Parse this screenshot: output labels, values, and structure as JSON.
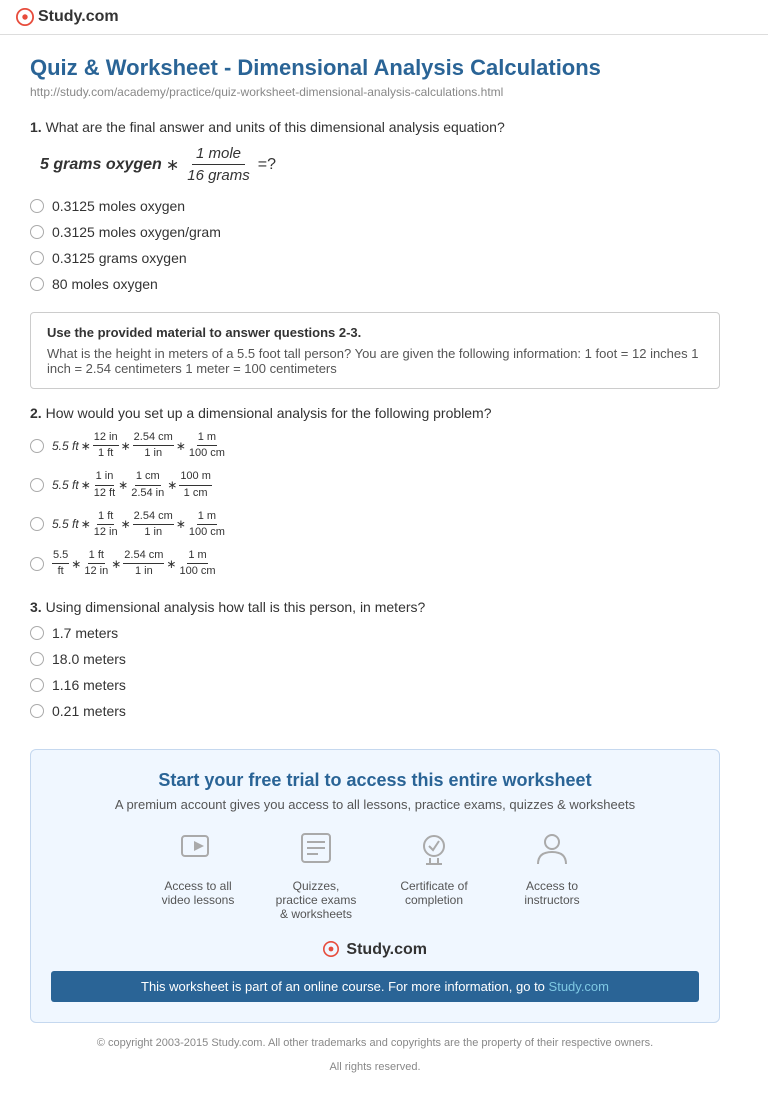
{
  "header": {
    "logo_text": "Study.com",
    "logo_dot": "●"
  },
  "page": {
    "title": "Quiz & Worksheet - Dimensional Analysis Calculations",
    "url": "http://study.com/academy/practice/quiz-worksheet-dimensional-analysis-calculations.html"
  },
  "questions": [
    {
      "number": "1.",
      "text": "What are the final answer and units of this dimensional analysis equation?",
      "equation_parts": {
        "left": "5 grams oxygen",
        "operator": "*",
        "numerator": "1 mole",
        "denominator": "16 grams",
        "result": "=?"
      },
      "options": [
        "0.3125 moles oxygen",
        "0.3125 moles oxygen/gram",
        "0.3125 grams oxygen",
        "80 moles oxygen"
      ]
    },
    {
      "info_box": {
        "title": "Use the provided material to answer questions 2-3.",
        "text": "What is the height in meters of a 5.5 foot tall person? You are given the following information: 1 foot = 12 inches 1 inch = 2.54 centimeters 1 meter = 100 centimeters"
      }
    },
    {
      "number": "2.",
      "text": "How would you set up a dimensional analysis for the following problem?",
      "options": [
        {
          "id": "a",
          "parts": [
            "5.5 ft",
            "*",
            "12in/1ft",
            "*",
            "2.54cm/1in",
            "*",
            "1m/100cm"
          ]
        },
        {
          "id": "b",
          "parts": [
            "5.5 ft",
            "*",
            "1in/12ft",
            "*",
            "1cm/2.54in",
            "*",
            "100m/1cm"
          ]
        },
        {
          "id": "c",
          "parts": [
            "5.5 ft",
            "*",
            "1ft/12in",
            "*",
            "2.54cm/1in",
            "*",
            "1m/100cm"
          ]
        },
        {
          "id": "d",
          "parts": [
            "5.5/ft",
            "*",
            "1ft/12in",
            "*",
            "2.54cm/1in",
            "*",
            "1m/100cm"
          ]
        }
      ]
    },
    {
      "number": "3.",
      "text": "Using dimensional analysis how tall is this person, in meters?",
      "options": [
        "1.7 meters",
        "18.0 meters",
        "1.16 meters",
        "0.21 meters"
      ]
    }
  ],
  "promo": {
    "title": "Start your free trial to access this entire worksheet",
    "subtitle": "A premium account gives you access to all lessons, practice exams, quizzes & worksheets",
    "features": [
      {
        "icon": "▶",
        "label": "Access to all video lessons"
      },
      {
        "icon": "☰",
        "label": "Quizzes, practice exams & worksheets"
      },
      {
        "icon": "✓",
        "label": "Certificate of completion"
      },
      {
        "icon": "👤",
        "label": "Access to instructors"
      }
    ],
    "logo": "Study.com",
    "banner_text": "This worksheet is part of an online course. For more information, go to",
    "banner_link": "Study.com"
  },
  "footer": {
    "copyright": "© copyright 2003-2015 Study.com. All other trademarks and copyrights are the property of their respective owners.",
    "rights": "All rights reserved."
  }
}
